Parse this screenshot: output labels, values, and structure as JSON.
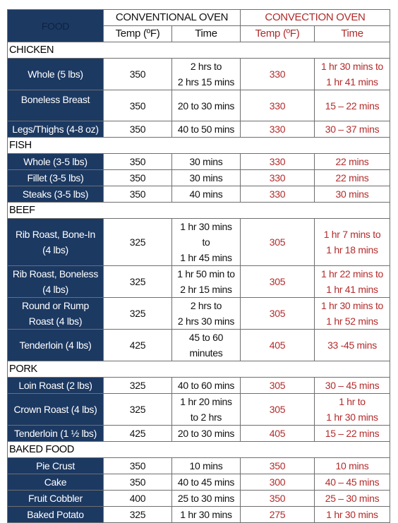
{
  "header": {
    "food": "FOOD",
    "conventional_oven": "CONVENTIONAL OVEN",
    "convection_oven": "CONVECTION OVEN",
    "temp_label": "Temp (ºF)",
    "time_label": "Time"
  },
  "colors": {
    "food_column_bg": "#1c3962",
    "convection_text": "#b42b2b",
    "conventional_text": "#111111"
  },
  "sections": [
    {
      "category": "CHICKEN",
      "rows": [
        {
          "food": [
            "Whole (5 lbs)"
          ],
          "conv_temp": "350",
          "conv_time": [
            "2 hrs to",
            "2 hrs 15 mins"
          ],
          "convec_temp": "330",
          "convec_time": [
            "1 hr 30 mins to",
            "1 hr 41 mins"
          ]
        },
        {
          "food": [
            "Boneless Breast"
          ],
          "conv_temp": "350",
          "conv_time": [
            "20 to 30 mins"
          ],
          "convec_temp": "330",
          "convec_time": [
            "15 – 22 mins"
          ]
        },
        {
          "food": [
            "Legs/Thighs (4-8 oz)"
          ],
          "conv_temp": "350",
          "conv_time": [
            "40 to 50 mins"
          ],
          "convec_temp": "330",
          "convec_time": [
            "30 – 37 mins"
          ]
        }
      ]
    },
    {
      "category": "FISH",
      "rows": [
        {
          "food": [
            "Whole (3-5 lbs)"
          ],
          "conv_temp": "350",
          "conv_time": [
            "30 mins"
          ],
          "convec_temp": "330",
          "convec_time": [
            "22 mins"
          ]
        },
        {
          "food": [
            "Fillet (3-5 lbs)"
          ],
          "conv_temp": "350",
          "conv_time": [
            "30 mins"
          ],
          "convec_temp": "330",
          "convec_time": [
            "22 mins"
          ]
        },
        {
          "food": [
            "Steaks (3-5 lbs)"
          ],
          "conv_temp": "350",
          "conv_time": [
            "40 mins"
          ],
          "convec_temp": "330",
          "convec_time": [
            "30 mins"
          ]
        }
      ]
    },
    {
      "category": "BEEF",
      "rows": [
        {
          "food": [
            "Rib Roast, Bone-In",
            "(4 lbs)"
          ],
          "conv_temp": "325",
          "conv_time": [
            "1 hr 30 mins",
            "to",
            "1 hr 45 mins"
          ],
          "convec_temp": "305",
          "convec_time": [
            "1 hr 7 mins to",
            "1 hr 18 mins"
          ]
        },
        {
          "food": [
            "Rib Roast, Boneless",
            "(4 lbs)"
          ],
          "conv_temp": "325",
          "conv_time": [
            "1 hr 50 min to",
            "2 hr 15 mins"
          ],
          "convec_temp": "305",
          "convec_time": [
            "1 hr 22 mins to",
            "1 hr 41 mins"
          ]
        },
        {
          "food": [
            "Round or Rump",
            "Roast (4 lbs)"
          ],
          "conv_temp": "325",
          "conv_time": [
            "2 hrs to",
            "2 hrs 30 mins"
          ],
          "convec_temp": "305",
          "convec_time": [
            "1 hr 30 mins to",
            "1 hr 52 mins"
          ]
        },
        {
          "food": [
            "Tenderloin (4 lbs)"
          ],
          "conv_temp": "425",
          "conv_time": [
            "45 to 60",
            "minutes"
          ],
          "convec_temp": "405",
          "convec_time": [
            "33 -45 mins"
          ]
        }
      ]
    },
    {
      "category": "PORK",
      "rows": [
        {
          "food": [
            "Loin Roast (2 lbs)"
          ],
          "conv_temp": "325",
          "conv_time": [
            "40 to 60 mins"
          ],
          "convec_temp": "305",
          "convec_time": [
            "30 – 45 mins"
          ]
        },
        {
          "food": [
            "Crown Roast (4 lbs)"
          ],
          "conv_temp": "325",
          "conv_time": [
            "1 hr 20 mins",
            "to 2 hrs"
          ],
          "convec_temp": "305",
          "convec_time": [
            "1 hr to",
            "1 hr 30 mins"
          ]
        },
        {
          "food": [
            "Tenderloin (1 ½ lbs)"
          ],
          "conv_temp": "425",
          "conv_time": [
            "20 to 30 mins"
          ],
          "convec_temp": "405",
          "convec_time": [
            "15 – 22 mins"
          ]
        }
      ]
    },
    {
      "category": "BAKED FOOD",
      "rows": [
        {
          "food": [
            "Pie Crust"
          ],
          "conv_temp": "350",
          "conv_time": [
            "10 mins"
          ],
          "convec_temp": "350",
          "convec_time": [
            "10 mins"
          ]
        },
        {
          "food": [
            "Cake"
          ],
          "conv_temp": "350",
          "conv_time": [
            "40 to 45 mins"
          ],
          "convec_temp": "300",
          "convec_time": [
            "40 – 45 mins"
          ]
        },
        {
          "food": [
            "Fruit Cobbler"
          ],
          "conv_temp": "400",
          "conv_time": [
            "25 to 30 mins"
          ],
          "convec_temp": "350",
          "convec_time": [
            "25 – 30 mins"
          ]
        },
        {
          "food": [
            "Baked Potato"
          ],
          "conv_temp": "325",
          "conv_time": [
            "1 hr 30 mins"
          ],
          "convec_temp": "275",
          "convec_time": [
            "1 hr 30 mins"
          ]
        }
      ]
    }
  ]
}
